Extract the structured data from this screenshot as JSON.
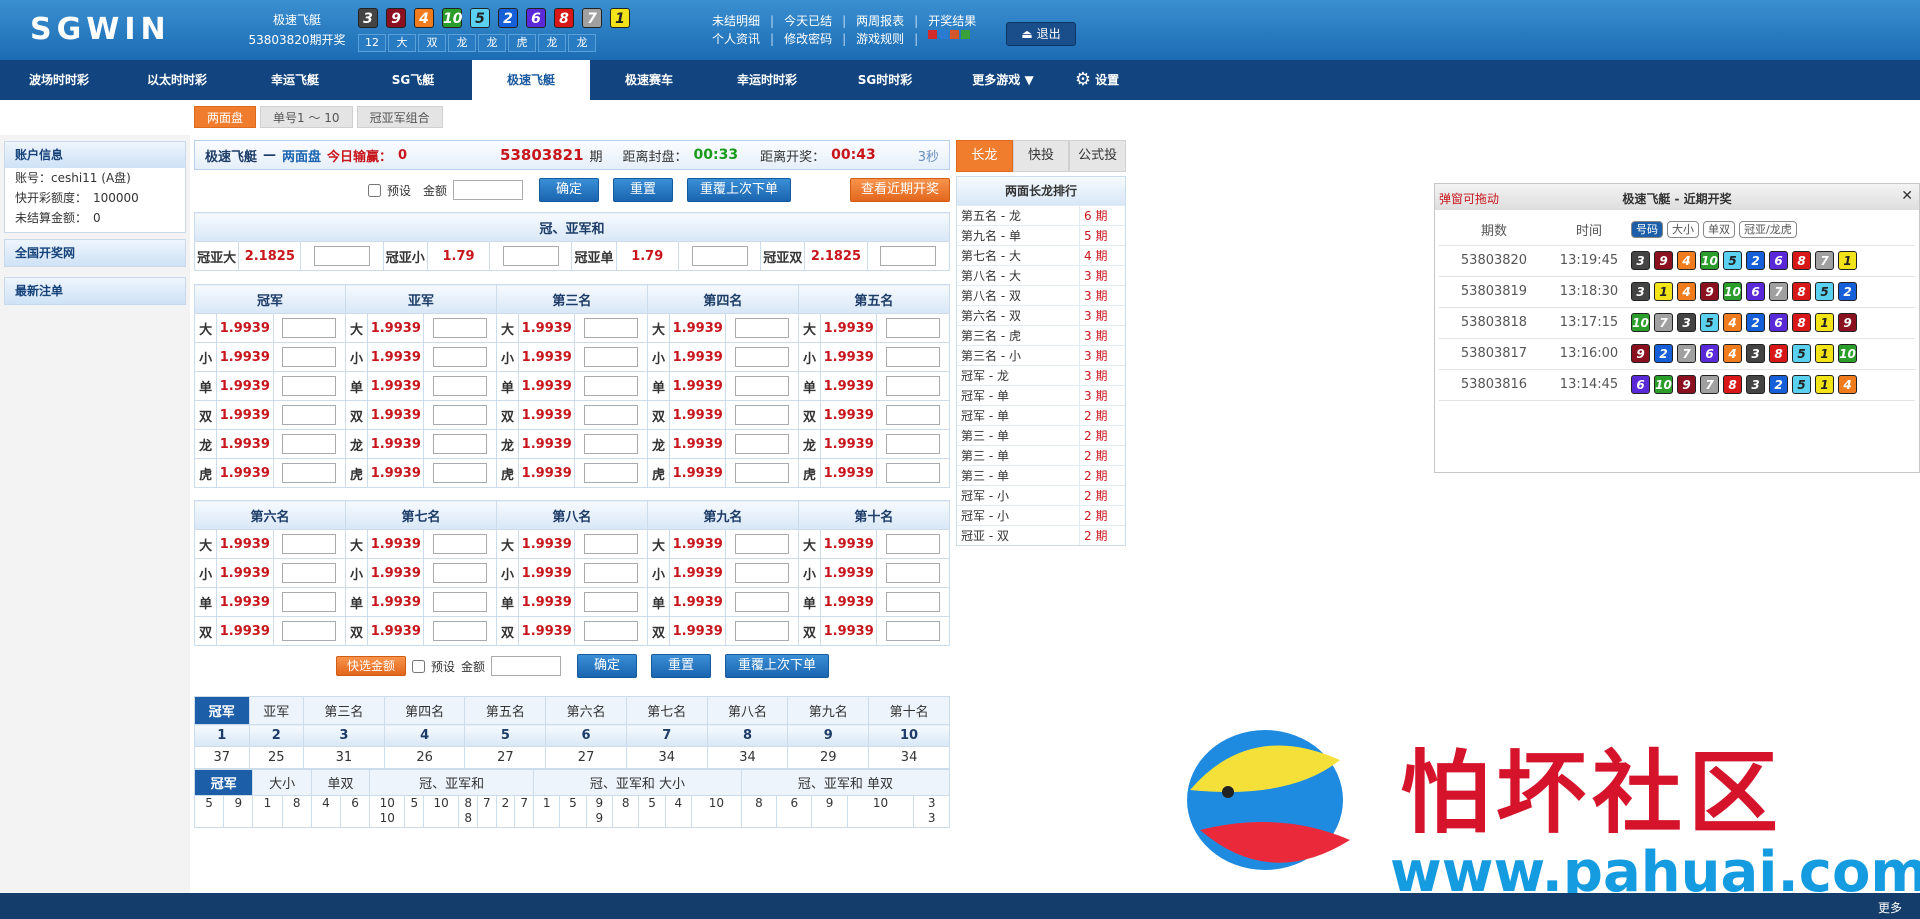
{
  "header": {
    "logo": "SGWIN",
    "game_name": "极速飞艇",
    "last_draw": "53803820期开奖",
    "balls": [
      "3",
      "9",
      "4",
      "10",
      "5",
      "2",
      "6",
      "8",
      "7",
      "1"
    ],
    "ball_colors": [
      "#444444",
      "#8b1020",
      "#f07c1e",
      "#2a9d2a",
      "#5ad1f0",
      "#1560d8",
      "#5a2ad8",
      "#d81818",
      "#a0a0a0",
      "#f2e418"
    ],
    "stats": [
      "12",
      "大",
      "双",
      "龙",
      "龙",
      "虎",
      "龙",
      "龙"
    ],
    "links_row1": [
      "未结明细",
      "今天已结",
      "两周报表",
      "开奖结果"
    ],
    "links_row2": [
      "个人资讯",
      "修改密码",
      "游戏规则"
    ],
    "logout": "退出"
  },
  "nav": {
    "items": [
      "波场时时彩",
      "以太时时彩",
      "幸运飞艇",
      "SG飞艇",
      "极速飞艇",
      "极速赛车",
      "幸运时时彩",
      "SG时时彩",
      "更多游戏 ▼"
    ],
    "settings": "设置"
  },
  "subtabs": [
    "两面盘",
    "单号1 ～ 10",
    "冠亚军组合"
  ],
  "sidebar": {
    "account_title": "账户信息",
    "account_lines": [
      "账号：ceshi11 (A盘)",
      "快开彩额度：　100000",
      "未结算金额：　0"
    ],
    "national": "全国开奖网",
    "recent_bets": "最新注单"
  },
  "info": {
    "game": "极速飞艇",
    "mode": "两面盘",
    "today_label": "今日输赢：",
    "today_value": "0",
    "period": "53803821",
    "period_suffix": "期",
    "close_label": "距离封盘：",
    "close_time": "00:33",
    "open_label": "距离开奖：",
    "open_time": "00:43",
    "refresh": "3秒"
  },
  "controls": {
    "preset": "预设",
    "amount": "金额",
    "confirm": "确定",
    "reset": "重置",
    "repeat": "重覆上次下单",
    "recent": "查看近期开奖",
    "quick": "快选金额"
  },
  "gy": {
    "title": "冠、亚军和",
    "items": [
      {
        "l": "冠亚大",
        "o": "2.1825"
      },
      {
        "l": "冠亚小",
        "o": "1.79"
      },
      {
        "l": "冠亚单",
        "o": "1.79"
      },
      {
        "l": "冠亚双",
        "o": "2.1825"
      }
    ]
  },
  "ranks_top": [
    "冠军",
    "亚军",
    "第三名",
    "第四名",
    "第五名"
  ],
  "ranks_bottom": [
    "第六名",
    "第七名",
    "第八名",
    "第九名",
    "第十名"
  ],
  "bet_types_top": [
    "大",
    "小",
    "单",
    "双",
    "龙",
    "虎"
  ],
  "bet_types_bottom": [
    "大",
    "小",
    "单",
    "双"
  ],
  "odds": "1.9939",
  "ribbon": {
    "tabs": [
      "冠军",
      "亚军",
      "第三名",
      "第四名",
      "第五名",
      "第六名",
      "第七名",
      "第八名",
      "第九名",
      "第十名"
    ],
    "numbers": [
      "1",
      "2",
      "3",
      "4",
      "5",
      "6",
      "7",
      "8",
      "9",
      "10"
    ],
    "counts": [
      "37",
      "25",
      "31",
      "26",
      "27",
      "27",
      "34",
      "34",
      "29",
      "34"
    ],
    "tabs2": [
      "冠军",
      "大小",
      "单双",
      "冠、亚军和",
      "冠、亚军和 大小",
      "冠、亚军和 单双"
    ],
    "seq": [
      "5",
      "9",
      "1",
      "8",
      "4",
      "6",
      "10\n10",
      "5",
      "10",
      "8\n8",
      "7",
      "2",
      "7",
      "1",
      "5",
      "9\n9",
      "8",
      "5",
      "4",
      "10",
      "8",
      "6",
      "9",
      "10",
      "3\n3"
    ]
  },
  "right": {
    "tabs": [
      "长龙",
      "快投",
      "公式投"
    ],
    "title": "两面长龙排行",
    "rows": [
      [
        "第五名 - 龙",
        "6 期"
      ],
      [
        "第九名 - 单",
        "5 期"
      ],
      [
        "第七名 - 大",
        "4 期"
      ],
      [
        "第八名 - 大",
        "3 期"
      ],
      [
        "第八名 - 双",
        "3 期"
      ],
      [
        "第六名 - 双",
        "3 期"
      ],
      [
        "第三名 - 虎",
        "3 期"
      ],
      [
        "第三名 - 小",
        "3 期"
      ],
      [
        "冠军 - 龙",
        "3 期"
      ],
      [
        "冠军 - 单",
        "3 期"
      ],
      [
        "冠军 - 单",
        "2 期"
      ],
      [
        "第三 - 单",
        "2 期"
      ],
      [
        "第三 - 单",
        "2 期"
      ],
      [
        "第三 - 单",
        "2 期"
      ],
      [
        "冠军 - 小",
        "2 期"
      ],
      [
        "冠军 - 小",
        "2 期"
      ],
      [
        "冠亚 - 双",
        "2 期"
      ]
    ]
  },
  "recent_panel": {
    "drag": "弹窗可拖动",
    "title": "极速飞艇 - 近期开奖",
    "cols": [
      "期数",
      "时间"
    ],
    "filters": [
      "号码",
      "大小",
      "单双",
      "冠亚/龙虎"
    ],
    "rows": [
      {
        "p": "53803820",
        "t": "13:19:45",
        "n": [
          "3",
          "9",
          "4",
          "10",
          "5",
          "2",
          "6",
          "8",
          "7",
          "1"
        ]
      },
      {
        "p": "53803819",
        "t": "13:18:30",
        "n": [
          "3",
          "1",
          "4",
          "9",
          "10",
          "6",
          "7",
          "8",
          "5",
          "2"
        ]
      },
      {
        "p": "53803818",
        "t": "13:17:15",
        "n": [
          "10",
          "7",
          "3",
          "5",
          "4",
          "2",
          "6",
          "8",
          "1",
          "9"
        ]
      },
      {
        "p": "53803817",
        "t": "13:16:00",
        "n": [
          "9",
          "2",
          "7",
          "6",
          "4",
          "3",
          "8",
          "5",
          "1",
          "10"
        ]
      },
      {
        "p": "53803816",
        "t": "13:14:45",
        "n": [
          "6",
          "10",
          "9",
          "7",
          "8",
          "3",
          "2",
          "5",
          "1",
          "4"
        ]
      }
    ],
    "num_colors": {
      "1": "#f2e418",
      "2": "#1560d8",
      "3": "#444444",
      "4": "#f07c1e",
      "5": "#5ad1f0",
      "6": "#5a2ad8",
      "7": "#a0a0a0",
      "8": "#d81818",
      "9": "#8b1020",
      "10": "#2a9d2a"
    }
  },
  "footer": {
    "more": "更多"
  },
  "watermark": {
    "cn": "怕坏社区",
    "url": "www.pahuai.com"
  }
}
